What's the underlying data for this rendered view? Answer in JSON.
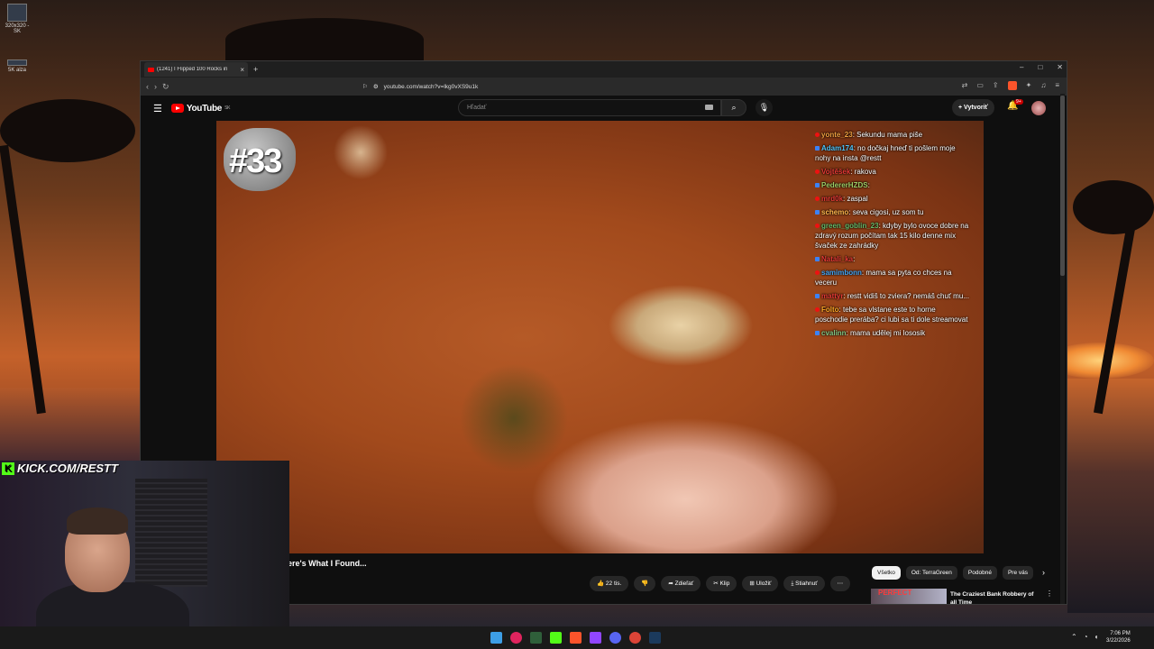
{
  "desktop": {
    "icon1_label": "320x320 - SK",
    "icon2_label": "5K alza"
  },
  "browser": {
    "tab_title": "(1241) I Flipped 100 Rocks in",
    "url": "youtube.com/watch?v=lkg0vXS9u1k"
  },
  "youtube": {
    "logo_text": "YouTube",
    "logo_region": "SK",
    "search_placeholder": "Hľadať",
    "create_label": "Vytvoriť",
    "notif_count": "9+"
  },
  "video": {
    "overlay_number": "#33",
    "title": "ere's What I Found...",
    "actions": [
      {
        "label": "22 tis.",
        "icon": "thumbs-up-icon"
      },
      {
        "label": "",
        "icon": "thumbs-down-icon"
      },
      {
        "label": "Zdieľať",
        "icon": "share-icon"
      },
      {
        "label": "Klip",
        "icon": "scissors-icon"
      },
      {
        "label": "Uložiť",
        "icon": "save-icon"
      },
      {
        "label": "Stiahnuť",
        "icon": "download-icon"
      }
    ]
  },
  "chips": [
    "Všetko",
    "Od: TerraGreen",
    "Podobné",
    "Pre vás"
  ],
  "recommendation": {
    "thumb_text": "PERFECT",
    "title": "The Craziest Bank Robbery of all Time"
  },
  "chat": [
    {
      "user": "yonte_23",
      "text": "Sekundu mama piše",
      "color": "#f0a040"
    },
    {
      "user": "Adam174",
      "text": "no dočkaj hneď ti pošlem moje nohy na insta @restt",
      "color": "#4fc3f7"
    },
    {
      "user": "Vojtěšek",
      "text": "rakova",
      "color": "#e53935"
    },
    {
      "user": "PedererHZDS",
      "text": "",
      "color": "#9ccc65"
    },
    {
      "user": "mrd0k",
      "text": "zaspal",
      "color": "#e53935"
    },
    {
      "user": "schemo",
      "text": "seva cigosi, uz som tu",
      "color": "#ffb74d"
    },
    {
      "user": "green_goblin_23",
      "text": "kdyby bylo ovoce dobre na zdravý rozum počítam tak 15 kilo denne mix švaček ze zahrádky",
      "color": "#66bb6a"
    },
    {
      "user": "Natali_ka",
      "text": "",
      "color": "#e53935"
    },
    {
      "user": "samimbonn",
      "text": "mama sa pyta co chces na veceru",
      "color": "#42a5f5"
    },
    {
      "user": "mattyr",
      "text": "restt vidiš to zviera? nemáš chuť mu...",
      "color": "#e53935"
    },
    {
      "user": "Folto",
      "text": "tebe sa vlstane este to horne poschodie prerába? ci lubi sa ti dole streamovat",
      "color": "#ffa726"
    },
    {
      "user": "cvalinn",
      "text": "mama udělej mi lososik",
      "color": "#81c784"
    }
  ],
  "stream": {
    "brand": "KICK.COM/RESTT"
  },
  "taskbar": {
    "time": "7:06 PM",
    "date": "3/22/2026"
  },
  "colors": {
    "youtube_red": "#ff0000",
    "kick_green": "#53fc18"
  }
}
